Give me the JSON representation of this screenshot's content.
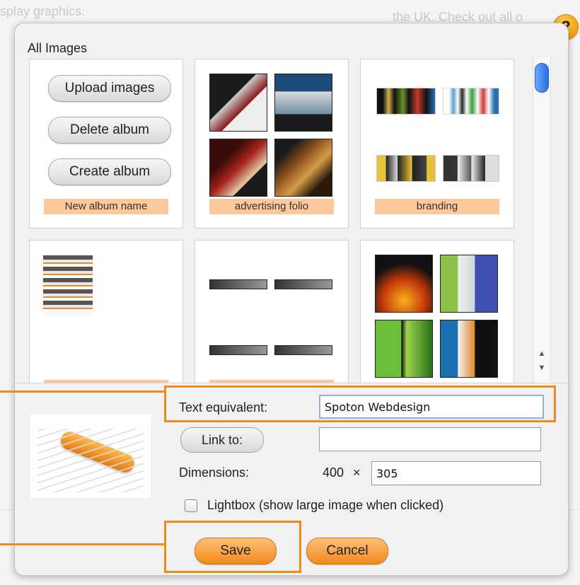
{
  "background": {
    "text_left": "splay graphics.",
    "text_right": "the UK. Check out all o"
  },
  "dialog": {
    "title": "All Images",
    "help_label": "?",
    "tiles": {
      "actions": {
        "upload": "Upload images",
        "delete": "Delete album",
        "create": "Create album",
        "new_album_placeholder": "New album name"
      },
      "albums": [
        "advertising folio",
        "branding"
      ]
    },
    "form": {
      "text_equivalent_label": "Text equivalent:",
      "text_equivalent_value": "Spoton Webdesign",
      "link_button": "Link to:",
      "link_value": "",
      "dimensions_label": "Dimensions:",
      "width": "400",
      "times": "×",
      "height": "305",
      "lightbox_label": "Lightbox (show large image when clicked)"
    },
    "buttons": {
      "save": "Save",
      "cancel": "Cancel"
    },
    "colors": {
      "accent": "#f08a1c",
      "label_bg": "#fdc89a",
      "scroll_thumb": "#2b6fe0"
    }
  }
}
